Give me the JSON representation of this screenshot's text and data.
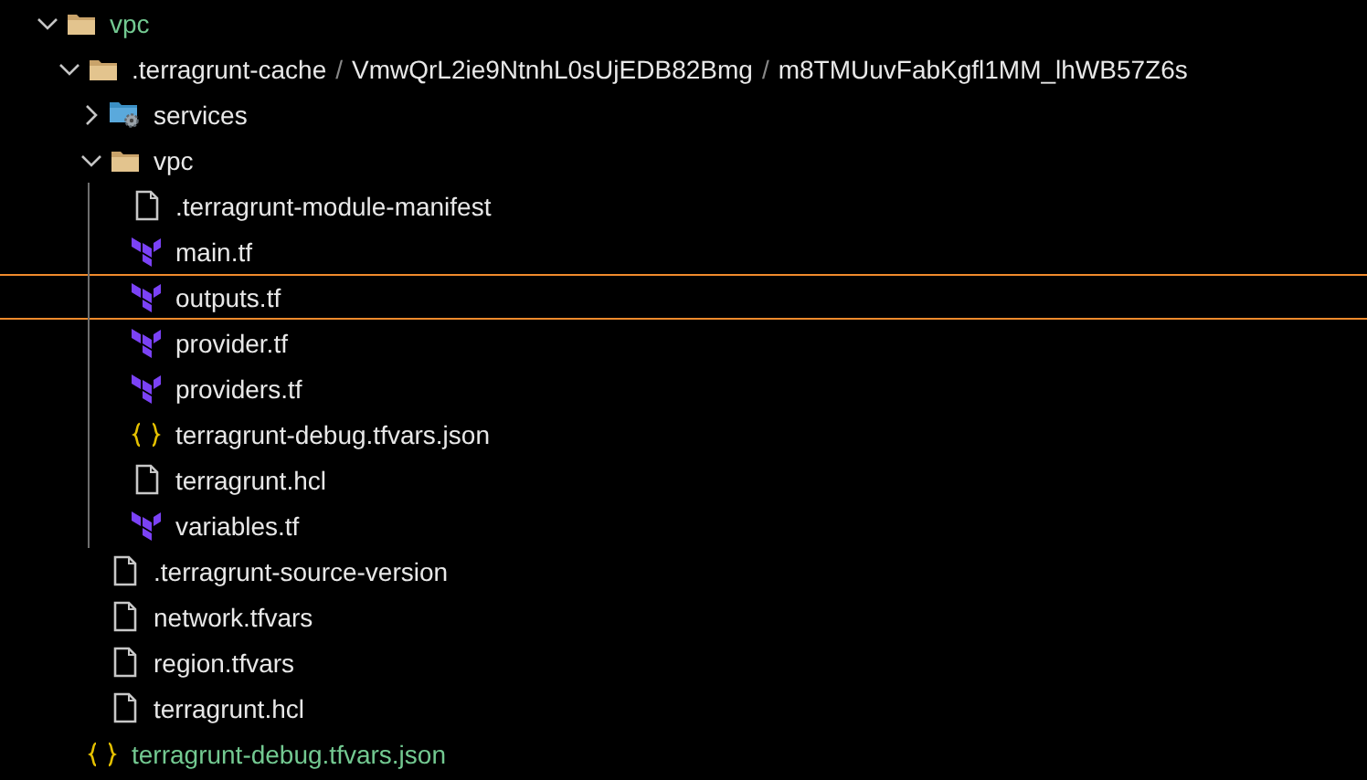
{
  "tree": [
    {
      "kind": "folder",
      "segments": [
        "vpc"
      ],
      "untracked": true,
      "expanded": true,
      "selected": false,
      "children": [
        {
          "kind": "folder",
          "segments": [
            ".terragrunt-cache",
            "VmwQrL2ie9NtnhL0sUjEDB82Bmg",
            "m8TMUuvFabKgfl1MM_lhWB57Z6s"
          ],
          "separator": "/",
          "untracked": false,
          "expanded": true,
          "selected": false,
          "children": [
            {
              "kind": "services",
              "segments": [
                "services"
              ],
              "untracked": false,
              "expanded": false,
              "selected": false
            },
            {
              "kind": "folder",
              "segments": [
                "vpc"
              ],
              "untracked": false,
              "expanded": true,
              "selected": false,
              "children": [
                {
                  "kind": "file",
                  "segments": [
                    ".terragrunt-module-manifest"
                  ],
                  "untracked": false,
                  "selected": false
                },
                {
                  "kind": "terraform",
                  "segments": [
                    "main.tf"
                  ],
                  "untracked": false,
                  "selected": false
                },
                {
                  "kind": "terraform",
                  "segments": [
                    "outputs.tf"
                  ],
                  "untracked": false,
                  "selected": true
                },
                {
                  "kind": "terraform",
                  "segments": [
                    "provider.tf"
                  ],
                  "untracked": false,
                  "selected": false
                },
                {
                  "kind": "terraform",
                  "segments": [
                    "providers.tf"
                  ],
                  "untracked": false,
                  "selected": false
                },
                {
                  "kind": "json",
                  "segments": [
                    "terragrunt-debug.tfvars.json"
                  ],
                  "untracked": false,
                  "selected": false
                },
                {
                  "kind": "file",
                  "segments": [
                    "terragrunt.hcl"
                  ],
                  "untracked": false,
                  "selected": false
                },
                {
                  "kind": "terraform",
                  "segments": [
                    "variables.tf"
                  ],
                  "untracked": false,
                  "selected": false
                }
              ]
            },
            {
              "kind": "file",
              "segments": [
                ".terragrunt-source-version"
              ],
              "untracked": false,
              "selected": false
            },
            {
              "kind": "file",
              "segments": [
                "network.tfvars"
              ],
              "untracked": false,
              "selected": false
            },
            {
              "kind": "file",
              "segments": [
                "region.tfvars"
              ],
              "untracked": false,
              "selected": false
            },
            {
              "kind": "file",
              "segments": [
                "terragrunt.hcl"
              ],
              "untracked": false,
              "selected": false
            }
          ]
        },
        {
          "kind": "json",
          "segments": [
            "terragrunt-debug.tfvars.json"
          ],
          "untracked": true,
          "selected": false
        }
      ]
    }
  ]
}
